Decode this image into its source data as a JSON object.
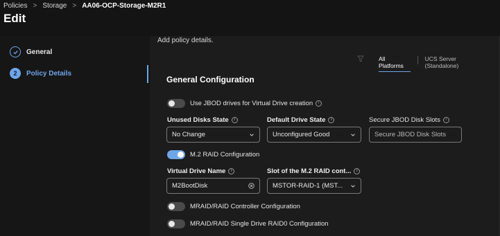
{
  "breadcrumb": {
    "items": [
      "Policies",
      "Storage"
    ],
    "current": "AA06-OCP-Storage-M2R1",
    "separator": ">"
  },
  "page": {
    "title": "Edit"
  },
  "steps": [
    {
      "number": "",
      "label": "General",
      "state": "done"
    },
    {
      "number": "2",
      "label": "Policy Details",
      "state": "active"
    }
  ],
  "main": {
    "intro": "Add policy details.",
    "platform_tabs": [
      {
        "label": "All Platforms",
        "active": true
      },
      {
        "label": "UCS Server (Standalone)",
        "active": false
      }
    ],
    "section_title": "General Configuration",
    "jbod_toggle": {
      "label": "Use JBOD drives for Virtual Drive creation",
      "on": false
    },
    "unused_disks": {
      "label": "Unused Disks State",
      "value": "No Change"
    },
    "default_drive": {
      "label": "Default Drive State",
      "value": "Unconfigured Good"
    },
    "secure_jbod": {
      "label": "Secure JBOD Disk Slots",
      "placeholder": "Secure JBOD Disk Slots",
      "value": ""
    },
    "m2_toggle": {
      "label": "M.2 RAID Configuration",
      "on": true
    },
    "virtual_drive_name": {
      "label": "Virtual Drive Name",
      "value": "M2BootDisk"
    },
    "m2_slot": {
      "label": "Slot of the M.2 RAID cont...",
      "value": "MSTOR-RAID-1 (MST..."
    },
    "mraid_toggle": {
      "label": "MRAID/RAID Controller Configuration",
      "on": false
    },
    "raid0_toggle": {
      "label": "MRAID/RAID Single Drive RAID0 Configuration",
      "on": false
    }
  },
  "colors": {
    "accent": "#6ea6e8",
    "background": "#141414",
    "panel": "#1c1c1c"
  }
}
